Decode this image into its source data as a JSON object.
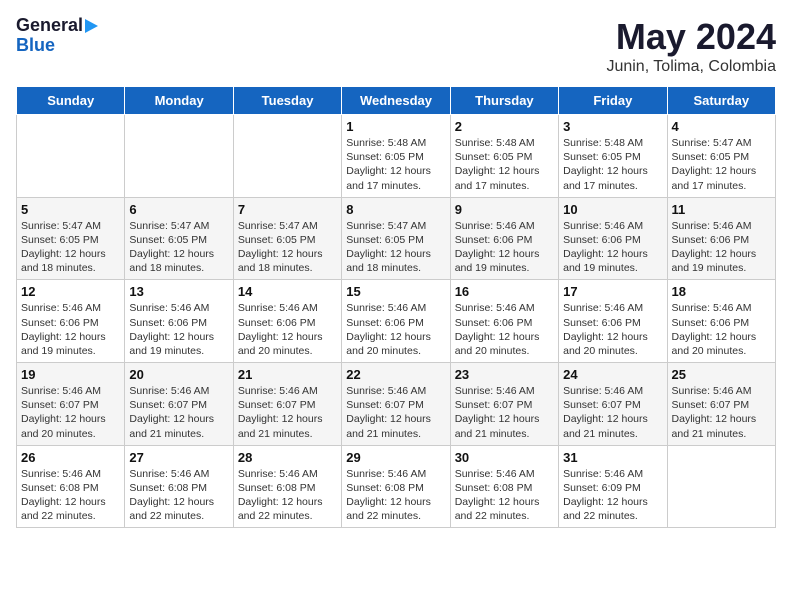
{
  "header": {
    "logo_general": "General",
    "logo_blue": "Blue",
    "main_title": "May 2024",
    "subtitle": "Junin, Tolima, Colombia"
  },
  "days_of_week": [
    "Sunday",
    "Monday",
    "Tuesday",
    "Wednesday",
    "Thursday",
    "Friday",
    "Saturday"
  ],
  "weeks": [
    {
      "days": [
        {
          "num": "",
          "info": ""
        },
        {
          "num": "",
          "info": ""
        },
        {
          "num": "",
          "info": ""
        },
        {
          "num": "1",
          "info": "Sunrise: 5:48 AM\nSunset: 6:05 PM\nDaylight: 12 hours and 17 minutes."
        },
        {
          "num": "2",
          "info": "Sunrise: 5:48 AM\nSunset: 6:05 PM\nDaylight: 12 hours and 17 minutes."
        },
        {
          "num": "3",
          "info": "Sunrise: 5:48 AM\nSunset: 6:05 PM\nDaylight: 12 hours and 17 minutes."
        },
        {
          "num": "4",
          "info": "Sunrise: 5:47 AM\nSunset: 6:05 PM\nDaylight: 12 hours and 17 minutes."
        }
      ]
    },
    {
      "days": [
        {
          "num": "5",
          "info": "Sunrise: 5:47 AM\nSunset: 6:05 PM\nDaylight: 12 hours and 18 minutes."
        },
        {
          "num": "6",
          "info": "Sunrise: 5:47 AM\nSunset: 6:05 PM\nDaylight: 12 hours and 18 minutes."
        },
        {
          "num": "7",
          "info": "Sunrise: 5:47 AM\nSunset: 6:05 PM\nDaylight: 12 hours and 18 minutes."
        },
        {
          "num": "8",
          "info": "Sunrise: 5:47 AM\nSunset: 6:05 PM\nDaylight: 12 hours and 18 minutes."
        },
        {
          "num": "9",
          "info": "Sunrise: 5:46 AM\nSunset: 6:06 PM\nDaylight: 12 hours and 19 minutes."
        },
        {
          "num": "10",
          "info": "Sunrise: 5:46 AM\nSunset: 6:06 PM\nDaylight: 12 hours and 19 minutes."
        },
        {
          "num": "11",
          "info": "Sunrise: 5:46 AM\nSunset: 6:06 PM\nDaylight: 12 hours and 19 minutes."
        }
      ]
    },
    {
      "days": [
        {
          "num": "12",
          "info": "Sunrise: 5:46 AM\nSunset: 6:06 PM\nDaylight: 12 hours and 19 minutes."
        },
        {
          "num": "13",
          "info": "Sunrise: 5:46 AM\nSunset: 6:06 PM\nDaylight: 12 hours and 19 minutes."
        },
        {
          "num": "14",
          "info": "Sunrise: 5:46 AM\nSunset: 6:06 PM\nDaylight: 12 hours and 20 minutes."
        },
        {
          "num": "15",
          "info": "Sunrise: 5:46 AM\nSunset: 6:06 PM\nDaylight: 12 hours and 20 minutes."
        },
        {
          "num": "16",
          "info": "Sunrise: 5:46 AM\nSunset: 6:06 PM\nDaylight: 12 hours and 20 minutes."
        },
        {
          "num": "17",
          "info": "Sunrise: 5:46 AM\nSunset: 6:06 PM\nDaylight: 12 hours and 20 minutes."
        },
        {
          "num": "18",
          "info": "Sunrise: 5:46 AM\nSunset: 6:06 PM\nDaylight: 12 hours and 20 minutes."
        }
      ]
    },
    {
      "days": [
        {
          "num": "19",
          "info": "Sunrise: 5:46 AM\nSunset: 6:07 PM\nDaylight: 12 hours and 20 minutes."
        },
        {
          "num": "20",
          "info": "Sunrise: 5:46 AM\nSunset: 6:07 PM\nDaylight: 12 hours and 21 minutes."
        },
        {
          "num": "21",
          "info": "Sunrise: 5:46 AM\nSunset: 6:07 PM\nDaylight: 12 hours and 21 minutes."
        },
        {
          "num": "22",
          "info": "Sunrise: 5:46 AM\nSunset: 6:07 PM\nDaylight: 12 hours and 21 minutes."
        },
        {
          "num": "23",
          "info": "Sunrise: 5:46 AM\nSunset: 6:07 PM\nDaylight: 12 hours and 21 minutes."
        },
        {
          "num": "24",
          "info": "Sunrise: 5:46 AM\nSunset: 6:07 PM\nDaylight: 12 hours and 21 minutes."
        },
        {
          "num": "25",
          "info": "Sunrise: 5:46 AM\nSunset: 6:07 PM\nDaylight: 12 hours and 21 minutes."
        }
      ]
    },
    {
      "days": [
        {
          "num": "26",
          "info": "Sunrise: 5:46 AM\nSunset: 6:08 PM\nDaylight: 12 hours and 22 minutes."
        },
        {
          "num": "27",
          "info": "Sunrise: 5:46 AM\nSunset: 6:08 PM\nDaylight: 12 hours and 22 minutes."
        },
        {
          "num": "28",
          "info": "Sunrise: 5:46 AM\nSunset: 6:08 PM\nDaylight: 12 hours and 22 minutes."
        },
        {
          "num": "29",
          "info": "Sunrise: 5:46 AM\nSunset: 6:08 PM\nDaylight: 12 hours and 22 minutes."
        },
        {
          "num": "30",
          "info": "Sunrise: 5:46 AM\nSunset: 6:08 PM\nDaylight: 12 hours and 22 minutes."
        },
        {
          "num": "31",
          "info": "Sunrise: 5:46 AM\nSunset: 6:09 PM\nDaylight: 12 hours and 22 minutes."
        },
        {
          "num": "",
          "info": ""
        }
      ]
    }
  ]
}
